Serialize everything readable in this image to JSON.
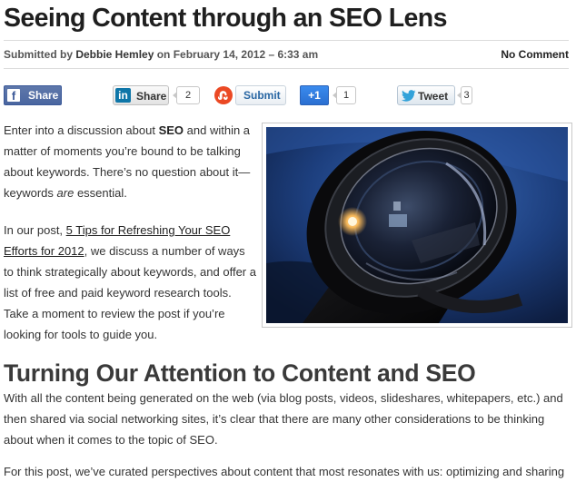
{
  "article": {
    "title": "Seeing Content through an SEO Lens",
    "meta": {
      "submitted_prefix": "Submitted by ",
      "author": "Debbie Hemley",
      "date_text": " on February 14, 2012 – 6:33 am",
      "comments": "No Comment"
    },
    "share": {
      "facebook": {
        "icon": "f",
        "label": "Share"
      },
      "linkedin": {
        "icon": "in",
        "label": "Share",
        "count": "2"
      },
      "stumbleupon": {
        "icon": "su",
        "label": "Submit"
      },
      "googleplus": {
        "label": "+1",
        "count": "1"
      },
      "twitter": {
        "label": "Tweet",
        "count": "3"
      }
    },
    "intro": {
      "p1_a": "Enter into a discussion about ",
      "p1_b": "SEO",
      "p1_c": " and within a matter of moments you’re bound to be talking about keywords.  There’s no question about it—keywords ",
      "p1_d": "are",
      "p1_e": " essential.",
      "p2_a": "In our post, ",
      "p2_link": "5 Tips for Refreshing Your SEO Efforts for 2012",
      "p2_b": ", we discuss a number of ways to think strategically about keywords, and offer a list of free and paid keyword research tools. Take a moment to review the post if you’re looking for tools to guide you."
    },
    "section_heading": "Turning Our Attention to Content and SEO",
    "p3": "With all the content being generated on the web (via blog posts, videos, slideshares, whitepapers, etc.) and then shared via social networking sites, it’s clear that there are many other considerations to be thinking about when it comes to the topic of SEO.",
    "p4": "For this post, we’ve curated perspectives about content that most resonates with us: optimizing and sharing"
  }
}
